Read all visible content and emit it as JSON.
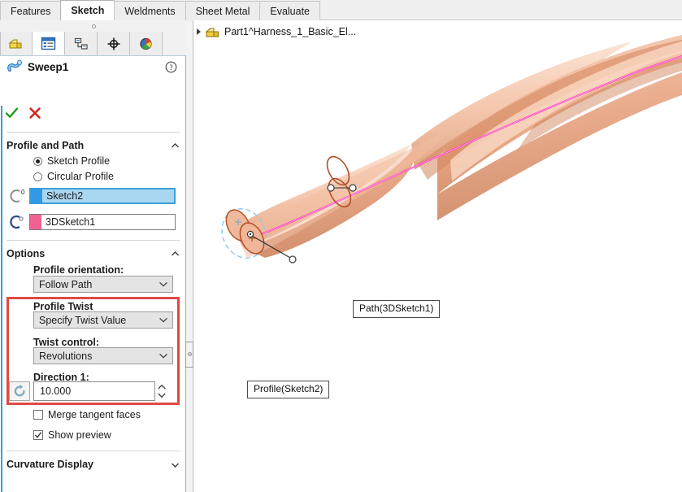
{
  "commandmanager": {
    "tabs": [
      {
        "label": "Features",
        "active": false
      },
      {
        "label": "Sketch",
        "active": true
      },
      {
        "label": "Weldments",
        "active": false
      },
      {
        "label": "Sheet Metal",
        "active": false
      },
      {
        "label": "Evaluate",
        "active": false
      }
    ]
  },
  "property_manager": {
    "tabs": [
      {
        "name": "feature-manager-design-tree-icon",
        "active": false
      },
      {
        "name": "property-manager-icon",
        "active": true
      },
      {
        "name": "configuration-manager-icon",
        "active": false
      },
      {
        "name": "dimxpert-manager-icon",
        "active": false
      },
      {
        "name": "display-manager-icon",
        "active": false
      }
    ],
    "feature_icon": "sweep-icon",
    "feature_title": "Sweep1",
    "help_icon": "help-question-icon",
    "ok_icon": "green-check-icon",
    "cancel_icon": "red-x-icon",
    "sections": {
      "profile_and_path": {
        "title": "Profile and Path",
        "collapse_icon": "chevron-up-icon",
        "radios": [
          {
            "label": "Sketch Profile",
            "selected": true
          },
          {
            "label": "Circular Profile",
            "selected": false
          }
        ],
        "selections": [
          {
            "icon": "profile-selection-icon",
            "swatch": "#3399e6",
            "value": "Sketch2",
            "active": true
          },
          {
            "icon": "path-selection-icon",
            "swatch": "#f06292",
            "value": "3DSketch1",
            "active": false
          }
        ]
      },
      "options": {
        "title": "Options",
        "collapse_icon": "chevron-up-icon",
        "profile_orientation": {
          "label": "Profile orientation:",
          "value": "Follow Path",
          "dropdown_icon": "chevron-down-icon"
        },
        "profile_twist": {
          "label": "Profile Twist",
          "value": "Specify Twist Value",
          "dropdown_icon": "chevron-down-icon"
        },
        "twist_control": {
          "label": "Twist control:",
          "value": "Revolutions",
          "dropdown_icon": "chevron-down-icon"
        },
        "direction1": {
          "label": "Direction 1:",
          "value": "10.000",
          "reverse_icon": "reverse-direction-icon",
          "spinner_icon": "spin-up-down-icon"
        },
        "checkboxes": [
          {
            "label": "Merge tangent faces",
            "checked": false
          },
          {
            "label": "Show preview",
            "checked": true
          }
        ]
      },
      "curvature_display": {
        "title": "Curvature Display",
        "collapse_icon": "chevron-down-icon"
      }
    },
    "highlight_color": "#e04a45"
  },
  "graphics": {
    "feature_tree": {
      "expand_icon": "triangle-right-icon",
      "part_icon": "part-document-icon",
      "label": "Part1^Harness_1_Basic_El..."
    },
    "callouts": [
      {
        "label": "Path(3DSketch1)",
        "name": "path-callout"
      },
      {
        "label": "Profile(Sketch2)",
        "name": "profile-callout"
      }
    ],
    "model": {
      "surface_color": "#f2bda1",
      "shadow_color": "#d89a78",
      "path_curve_color": "#ff2fbf",
      "sketch_circle_color": "#b0502a",
      "preview_ring_color": "#8cc6ef"
    }
  }
}
